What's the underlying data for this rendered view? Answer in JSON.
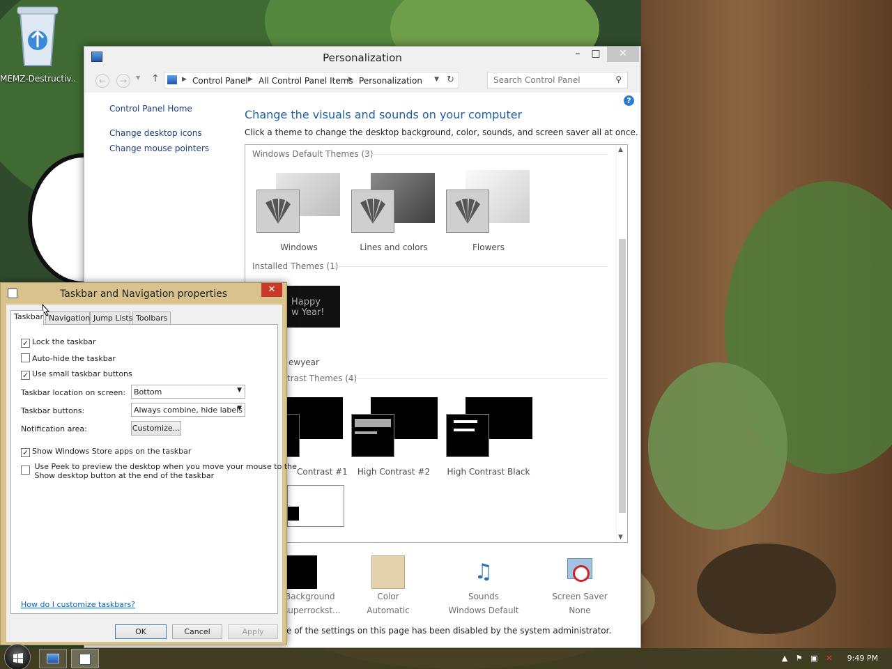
{
  "desktop": {
    "icon_label": "MEMZ-Destructiv..."
  },
  "personalization": {
    "title": "Personalization",
    "minimize": "–",
    "maximize": "□",
    "close": "✕",
    "breadcrumb": [
      "Control Panel",
      "All Control Panel Items",
      "Personalization"
    ],
    "search_placeholder": "Search Control Panel",
    "help": "?",
    "left_nav": {
      "home": "Control Panel Home",
      "desktop_icons": "Change desktop icons",
      "mouse_pointers": "Change mouse pointers"
    },
    "heading": "Change the visuals and sounds on your computer",
    "description": "Click a theme to change the desktop background, color, sounds, and screen saver all at once.",
    "groups": {
      "default": "Windows Default Themes (3)",
      "installed": "Installed Themes (1)",
      "high_contrast": "trast Themes (4)"
    },
    "default_themes": [
      "Windows",
      "Lines and colors",
      "Flowers"
    ],
    "installed_theme": {
      "label": "ewyear",
      "thumb_text_1": "Happy",
      "thumb_text_2": "w Year!"
    },
    "high_contrast_themes": [
      "Contrast #1",
      "High Contrast #2",
      "High Contrast Black"
    ],
    "bottom": {
      "background": {
        "name": "Background",
        "value": "superrockst..."
      },
      "color": {
        "name": "Color",
        "value": "Automatic"
      },
      "sounds": {
        "name": "Sounds",
        "value": "Windows Default"
      },
      "screensaver": {
        "name": "Screen Saver",
        "value": "None"
      }
    },
    "disabled_note": "e of the settings on this page has been disabled by the system administrator."
  },
  "dialog": {
    "title": "Taskbar and Navigation properties",
    "close": "✕",
    "tabs": [
      "Taskbar",
      "Navigation",
      "Jump Lists",
      "Toolbars"
    ],
    "options": {
      "lock": {
        "label": "Lock the taskbar",
        "checked": true
      },
      "autohide": {
        "label": "Auto-hide the taskbar",
        "checked": false
      },
      "small_buttons": {
        "label": "Use small taskbar buttons",
        "checked": true
      },
      "store_apps": {
        "label": "Show Windows Store apps on the taskbar",
        "checked": true
      },
      "peek_line1": "Use Peek to preview the desktop when you move your mouse to the",
      "peek_line2": "Show desktop button at the end of the taskbar"
    },
    "location_label": "Taskbar location on screen:",
    "location_value": "Bottom",
    "buttons_label": "Taskbar buttons:",
    "buttons_value": "Always combine, hide labels",
    "notification_label": "Notification area:",
    "customize": "Customize...",
    "help_link": "How do I customize taskbars?",
    "ok": "OK",
    "cancel": "Cancel",
    "apply": "Apply"
  },
  "taskbar": {
    "clock": "9:49 PM",
    "tray_icons": [
      "chevron-up-icon",
      "flag-icon",
      "network-icon",
      "volume-muted-icon"
    ]
  },
  "colors": {
    "heading_blue": "#1e5fa8",
    "dialog_frame": "#d9c28d",
    "close_red": "#c73a2a"
  }
}
